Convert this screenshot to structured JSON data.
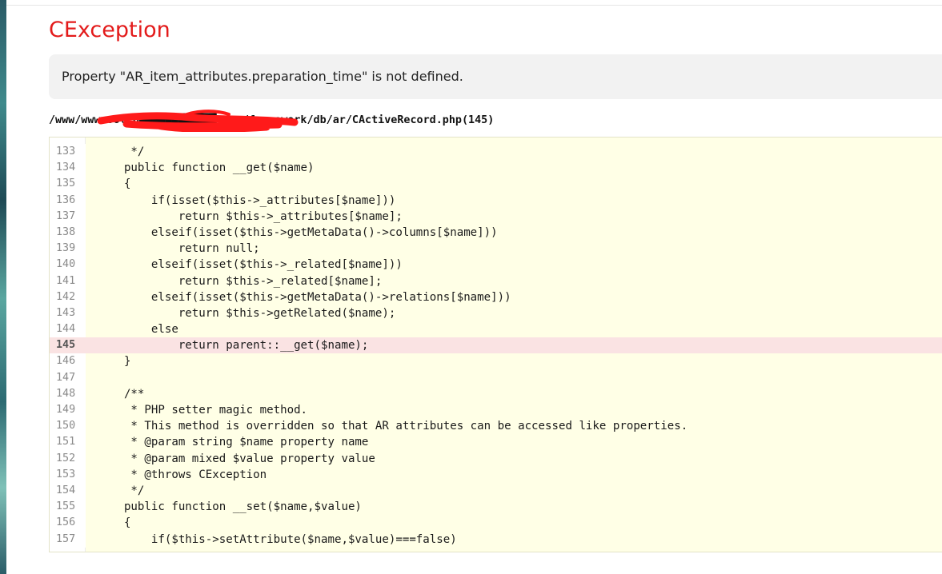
{
  "exception": {
    "title": "CException",
    "message": "Property \"AR_item_attributes.preparation_time\" is not defined.",
    "file_path": "/www/wwwroot/p████████████.com/framework/db/ar/CActiveRecord.php(145)"
  },
  "code": {
    "error_line": "145",
    "lines": [
      {
        "no": "133",
        "text": "     */"
      },
      {
        "no": "134",
        "text": "    public function __get($name)"
      },
      {
        "no": "135",
        "text": "    {"
      },
      {
        "no": "136",
        "text": "        if(isset($this->_attributes[$name]))"
      },
      {
        "no": "137",
        "text": "            return $this->_attributes[$name];"
      },
      {
        "no": "138",
        "text": "        elseif(isset($this->getMetaData()->columns[$name]))"
      },
      {
        "no": "139",
        "text": "            return null;"
      },
      {
        "no": "140",
        "text": "        elseif(isset($this->_related[$name]))"
      },
      {
        "no": "141",
        "text": "            return $this->_related[$name];"
      },
      {
        "no": "142",
        "text": "        elseif(isset($this->getMetaData()->relations[$name]))"
      },
      {
        "no": "143",
        "text": "            return $this->getRelated($name);"
      },
      {
        "no": "144",
        "text": "        else"
      },
      {
        "no": "145",
        "text": "            return parent::__get($name);"
      },
      {
        "no": "146",
        "text": "    }"
      },
      {
        "no": "147",
        "text": ""
      },
      {
        "no": "148",
        "text": "    /**"
      },
      {
        "no": "149",
        "text": "     * PHP setter magic method."
      },
      {
        "no": "150",
        "text": "     * This method is overridden so that AR attributes can be accessed like properties."
      },
      {
        "no": "151",
        "text": "     * @param string $name property name"
      },
      {
        "no": "152",
        "text": "     * @param mixed $value property value"
      },
      {
        "no": "153",
        "text": "     * @throws CException"
      },
      {
        "no": "154",
        "text": "     */"
      },
      {
        "no": "155",
        "text": "    public function __set($name,$value)"
      },
      {
        "no": "156",
        "text": "    {"
      },
      {
        "no": "157",
        "text": "        if($this->setAttribute($name,$value)===false)"
      }
    ]
  },
  "colors": {
    "title": "#e31b1b",
    "code_background": "#ffffe6",
    "error_line_background": "#fae3e3",
    "message_background": "#f2f2f2",
    "redaction": "#ff1a1a"
  }
}
